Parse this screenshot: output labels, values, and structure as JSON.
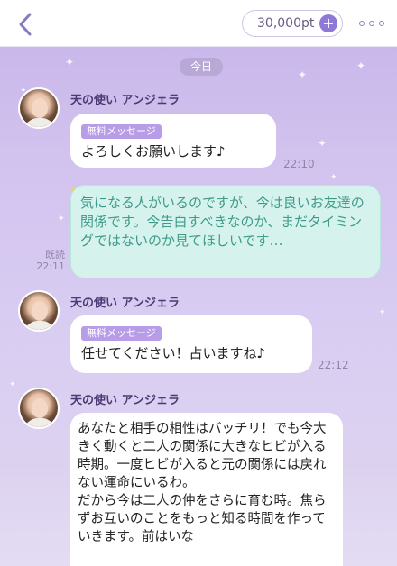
{
  "header": {
    "points": "30,000pt",
    "plus": "+"
  },
  "chat": {
    "date_label": "今日",
    "messages": [
      {
        "sender": "天の使い アンジェラ",
        "tag": "無料メッセージ",
        "text": "よろしくお願いします♪",
        "time": "22:10"
      },
      {
        "text": "気になる人がいるのですが、今は良いお友達の関係です。今告白すべきなのか、まだタイミングではないのか見てほしいです…",
        "read": "既読",
        "time": "22:11"
      },
      {
        "sender": "天の使い アンジェラ",
        "tag": "無料メッセージ",
        "text": "任せてください！占いますね♪",
        "time": "22:12"
      },
      {
        "sender": "天の使い アンジェラ",
        "text": "あなたと相手の相性はバッチリ！でも今大きく動くと二人の関係に大きなヒビが入る時期。一度ヒビが入ると元の関係には戻れない運命にいるわ。\nだから今は二人の仲をさらに育む時。焦らずお互いのことをもっと知る時間を作っていきます。前はいな"
      }
    ]
  }
}
